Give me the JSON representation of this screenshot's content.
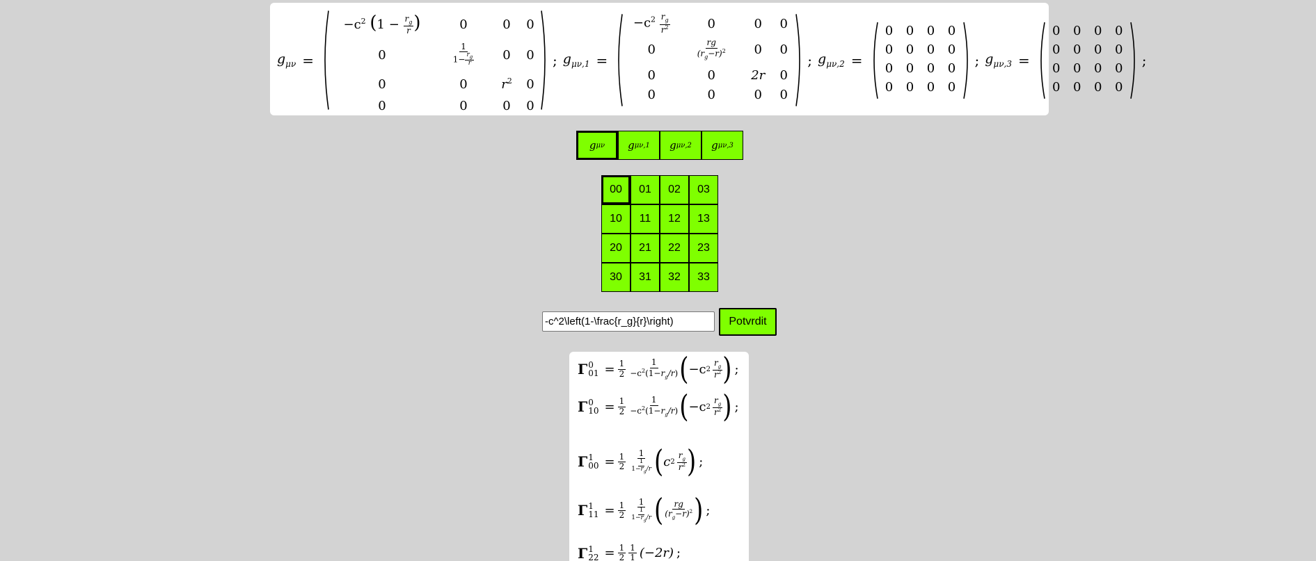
{
  "metric_panel": {
    "g": {
      "symbol": "g",
      "sub": "μν",
      "equals": "="
    },
    "g1": {
      "symbol": "g",
      "sub": "μν,1",
      "equals": "="
    },
    "g2": {
      "symbol": "g",
      "sub": "μν,2",
      "equals": "="
    },
    "g3": {
      "symbol": "g",
      "sub": "μν,3",
      "equals": "="
    },
    "separator": ";",
    "m0": {
      "r0c0_coef": "−c",
      "r0c0_exp": "2",
      "r0c0_inner": "1 −",
      "frac_num": "r",
      "frac_num_sub": "g",
      "frac_den": "r",
      "zero": "0",
      "one": "1",
      "one_minus": "1−",
      "r2": "r",
      "r2_exp": "2"
    },
    "m1": {
      "r0c0_coef": "−c",
      "r0c0_exp": "2",
      "r0c0_num": "r",
      "r0c0_num_sub": "g",
      "r0c0_den": "r",
      "r0c0_den_exp": "2",
      "r1c1_num": "rg",
      "r1c1_den": "(r",
      "r1c1_den_sub": "g",
      "r1c1_den_tail": "−r)",
      "r1c1_den_exp": "2",
      "r2c2": "2r",
      "zero": "0"
    },
    "zero": "0"
  },
  "tabs": [
    {
      "symbol": "g",
      "sub": "μν",
      "active": true
    },
    {
      "symbol": "g",
      "sub": "μν,1",
      "active": false
    },
    {
      "symbol": "g",
      "sub": "μν,2",
      "active": false
    },
    {
      "symbol": "g",
      "sub": "μν,3",
      "active": false
    }
  ],
  "index_grid": [
    "00",
    "01",
    "02",
    "03",
    "10",
    "11",
    "12",
    "13",
    "20",
    "21",
    "22",
    "23",
    "30",
    "31",
    "32",
    "33"
  ],
  "active_index": "00",
  "expression_input": {
    "value": "-c^2\\left(1-\\frac{r_g}{r}\\right)"
  },
  "confirm_button": {
    "label": "Potvrdit"
  },
  "results": {
    "gamma": "Γ",
    "half_num": "1",
    "half_den": "2",
    "one": "1",
    "equals": "=",
    "semicolon": ";",
    "lines": [
      {
        "upper": "0",
        "lower": "01"
      },
      {
        "upper": "0",
        "lower": "10"
      },
      {
        "upper": "1",
        "lower": "00"
      },
      {
        "upper": "1",
        "lower": "11"
      },
      {
        "upper": "1",
        "lower": "22"
      }
    ],
    "term_neg_c2": "−c",
    "term_c2": "c",
    "term_exp2": "2",
    "term_rg": "rg",
    "term_minus2r": "(−2r)",
    "denom_c2": "−c",
    "denom_one_minus": "1−"
  }
}
